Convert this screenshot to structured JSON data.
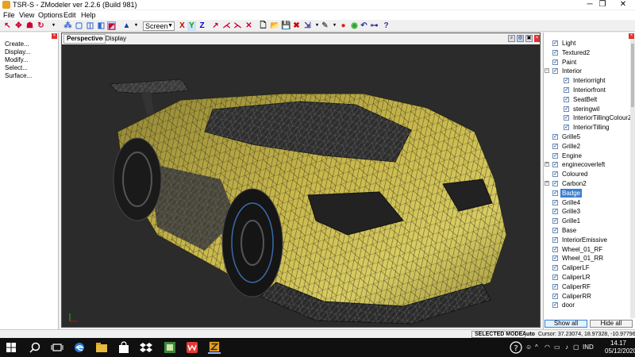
{
  "window": {
    "title": "TSR-S - ZModeler ver 2.2.6 (Build 981)",
    "controls": [
      "─",
      "❐",
      "✕"
    ]
  },
  "menu": [
    "File",
    "View",
    "Options",
    "Edit",
    "Help"
  ],
  "toolbar": {
    "screen_select": "Screen",
    "axes": [
      "X",
      "Y",
      "Z"
    ]
  },
  "left_panel": {
    "commands": [
      "Create...",
      "Display...",
      "Modify...",
      "Select...",
      "Surface..."
    ]
  },
  "viewport": {
    "tab": "Perspective",
    "mode": "‹  Display"
  },
  "layers": [
    {
      "name": "Light",
      "level": 0,
      "checked": true
    },
    {
      "name": "Textured2",
      "level": 0,
      "checked": true
    },
    {
      "name": "Paint",
      "level": 0,
      "checked": true
    },
    {
      "name": "Interior",
      "level": 0,
      "checked": true,
      "expander": "−"
    },
    {
      "name": "Interiorright",
      "level": 1,
      "checked": true
    },
    {
      "name": "Interiorfront",
      "level": 1,
      "checked": true
    },
    {
      "name": "SeatBelt",
      "level": 1,
      "checked": true
    },
    {
      "name": "steringwil",
      "level": 1,
      "checked": true
    },
    {
      "name": "InteriorTillingColourZon",
      "level": 1,
      "checked": true
    },
    {
      "name": "InteriorTilling",
      "level": 1,
      "checked": true
    },
    {
      "name": "Grille5",
      "level": 0,
      "checked": true
    },
    {
      "name": "Grille2",
      "level": 0,
      "checked": true
    },
    {
      "name": "Engine",
      "level": 0,
      "checked": true
    },
    {
      "name": "enginecoverleft",
      "level": 0,
      "checked": true,
      "expander": "+"
    },
    {
      "name": "Coloured",
      "level": 0,
      "checked": true
    },
    {
      "name": "Carbon2",
      "level": 0,
      "checked": true,
      "expander": "+"
    },
    {
      "name": "Badge",
      "level": 0,
      "checked": true,
      "selected": true
    },
    {
      "name": "Grille4",
      "level": 0,
      "checked": true
    },
    {
      "name": "Grille3",
      "level": 0,
      "checked": true
    },
    {
      "name": "Grille1",
      "level": 0,
      "checked": true
    },
    {
      "name": "Base",
      "level": 0,
      "checked": true
    },
    {
      "name": "InteriorEmissive",
      "level": 0,
      "checked": true
    },
    {
      "name": "Wheel_01_RF",
      "level": 0,
      "checked": true
    },
    {
      "name": "Wheel_01_RR",
      "level": 0,
      "checked": true
    },
    {
      "name": "CaliperLF",
      "level": 0,
      "checked": true
    },
    {
      "name": "CaliperLR",
      "level": 0,
      "checked": true
    },
    {
      "name": "CaliperRF",
      "level": 0,
      "checked": true
    },
    {
      "name": "CaliperRR",
      "level": 0,
      "checked": true
    },
    {
      "name": "door",
      "level": 0,
      "checked": true
    }
  ],
  "layer_buttons": {
    "show_all": "Show all",
    "hide_all": "Hide all"
  },
  "status": {
    "selected_mode": "SELECTED MODE",
    "auto": "Auto",
    "cursor": "Cursor: 37.23074, 18.97328, -10.97796"
  },
  "taskbar": {
    "lang": "IND",
    "time": "14.17",
    "date": "05/12/2020"
  },
  "colors": {
    "viewport_bg": "#2b2b2b",
    "body_paint": "#c9b84a",
    "selection": "#3c7fd0"
  }
}
